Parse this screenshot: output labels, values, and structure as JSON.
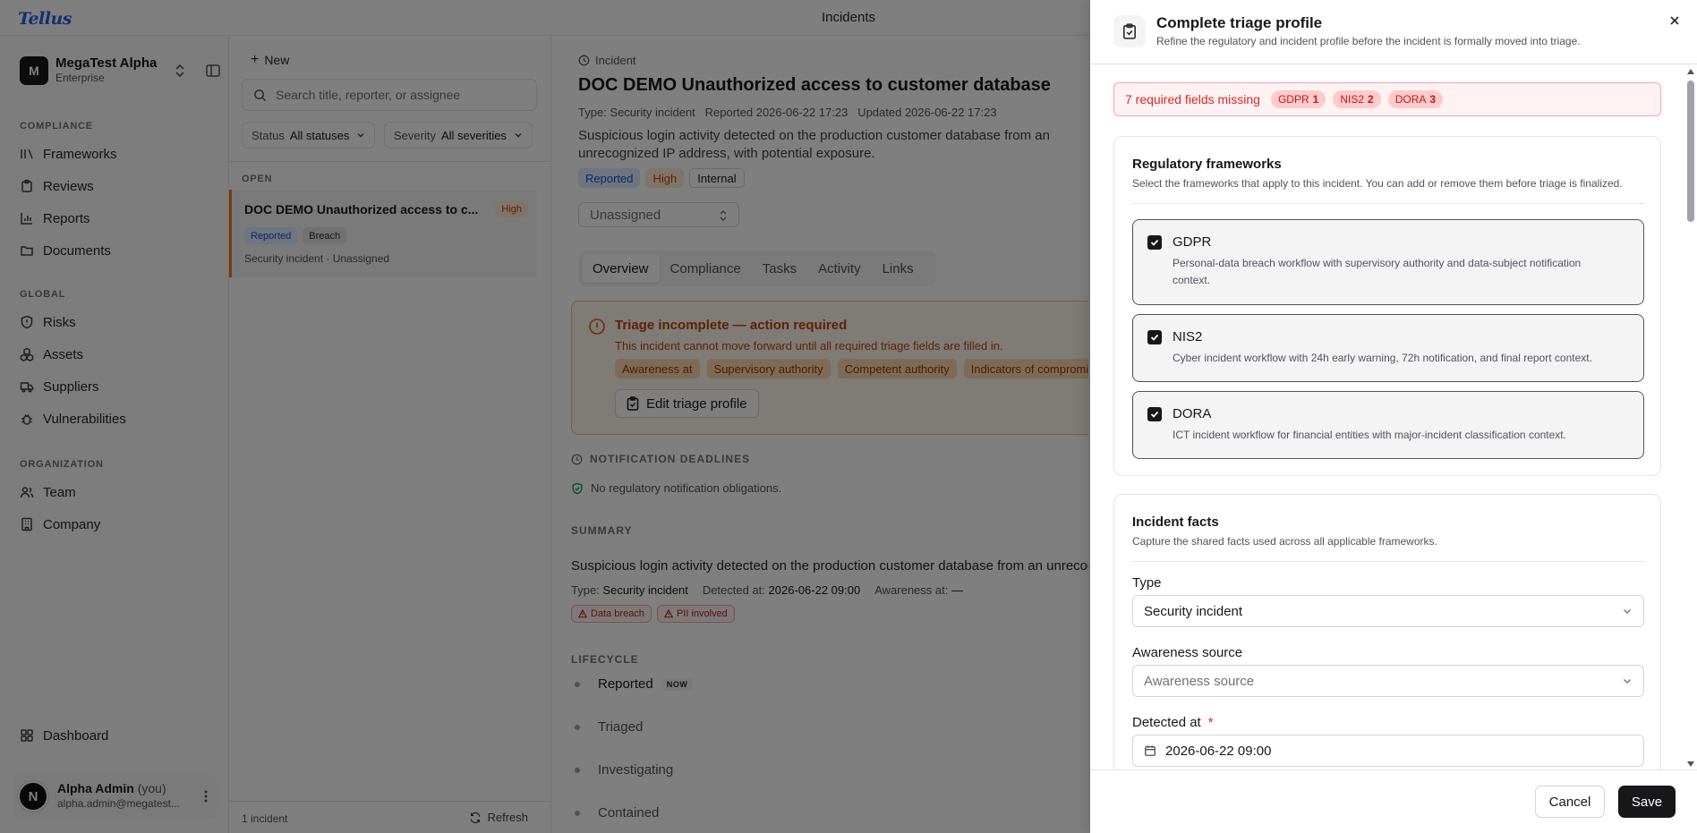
{
  "app": {
    "logo": "Tellus",
    "page_title": "Incidents"
  },
  "sidebar": {
    "org_initial": "M",
    "org_name": "MegaTest Alpha",
    "org_plan": "Enterprise",
    "sections": [
      {
        "label": "COMPLIANCE",
        "items": [
          {
            "label": "Frameworks",
            "icon": "layers-icon"
          },
          {
            "label": "Reviews",
            "icon": "clipboard-icon"
          },
          {
            "label": "Reports",
            "icon": "bar-chart-icon"
          },
          {
            "label": "Documents",
            "icon": "folder-icon"
          }
        ]
      },
      {
        "label": "GLOBAL",
        "items": [
          {
            "label": "Risks",
            "icon": "shield-alert-icon"
          },
          {
            "label": "Assets",
            "icon": "cubes-icon"
          },
          {
            "label": "Suppliers",
            "icon": "truck-icon"
          },
          {
            "label": "Vulnerabilities",
            "icon": "bug-icon"
          }
        ]
      },
      {
        "label": "ORGANIZATION",
        "items": [
          {
            "label": "Team",
            "icon": "users-icon"
          },
          {
            "label": "Company",
            "icon": "building-icon"
          }
        ]
      }
    ],
    "dashboard_label": "Dashboard",
    "user_initial": "N",
    "user_name": "Alpha Admin",
    "user_you": "(you)",
    "user_email": "alpha.admin@megatest..."
  },
  "list": {
    "new_label": "New",
    "search_placeholder": "Search title, reporter, or assignee",
    "filter_status_label": "Status",
    "filter_status_value": "All statuses",
    "filter_severity_label": "Severity",
    "filter_severity_value": "All severities",
    "group_label": "OPEN",
    "incident": {
      "title": "DOC DEMO Unauthorized access to c...",
      "severity": "High",
      "status": "Reported",
      "category": "Breach",
      "meta": "Security incident · Unassigned"
    },
    "count": "1 incident",
    "refresh_label": "Refresh"
  },
  "detail": {
    "crumb": "Incident",
    "title": "DOC DEMO Unauthorized access to customer database",
    "meta": "Type: Security incident   Reported 2026-06-22 17:23   Updated 2026-06-22 17:23",
    "description": "Suspicious login activity detected on the production customer database from an unrecognized IP address, with potential exposure.",
    "tags": [
      "Reported",
      "High",
      "Internal"
    ],
    "assignee": "Unassigned",
    "tabs": [
      "Overview",
      "Compliance",
      "Tasks",
      "Activity",
      "Links"
    ],
    "alert": {
      "title": "Triage incomplete — action required",
      "description": "This incident cannot move forward until all required triage fields are filled in.",
      "chips": [
        "Awareness at",
        "Supervisory authority",
        "Competent authority",
        "Indicators of compromise"
      ],
      "button": "Edit triage profile"
    },
    "deadlines_label": "NOTIFICATION DEADLINES",
    "no_obligations": "No regulatory notification obligations.",
    "summary_label": "SUMMARY",
    "summary_text": "Suspicious login activity detected on the production customer database from an unrecognized IP address.",
    "summary_type_label": "Type:",
    "summary_type_value": "Security incident",
    "summary_detected_label": "Detected at:",
    "summary_detected_value": "2026-06-22 09:00",
    "summary_awareness_label": "Awareness at:",
    "summary_awareness_value": "—",
    "summary_flags": [
      "Data breach",
      "PII involved"
    ],
    "lifecycle_label": "LIFECYCLE",
    "lifecycle": [
      "Reported",
      "Triaged",
      "Investigating",
      "Contained"
    ],
    "now_label": "NOW"
  },
  "modal": {
    "title": "Complete triage profile",
    "subtitle": "Refine the regulatory and incident profile before the incident is formally moved into triage.",
    "missing_text": "7 required fields missing",
    "missing_counts": [
      {
        "name": "GDPR",
        "count": "1"
      },
      {
        "name": "NIS2",
        "count": "2"
      },
      {
        "name": "DORA",
        "count": "3"
      }
    ],
    "frameworks_title": "Regulatory frameworks",
    "frameworks_sub": "Select the frameworks that apply to this incident. You can add or remove them before triage is finalized.",
    "frameworks": [
      {
        "name": "GDPR",
        "desc": "Personal-data breach workflow with supervisory authority and data-subject notification context.",
        "checked": true
      },
      {
        "name": "NIS2",
        "desc": "Cyber incident workflow with 24h early warning, 72h notification, and final report context.",
        "checked": true
      },
      {
        "name": "DORA",
        "desc": "ICT incident workflow for financial entities with major-incident classification context.",
        "checked": true
      }
    ],
    "facts_title": "Incident facts",
    "facts_sub": "Capture the shared facts used across all applicable frameworks.",
    "type_label": "Type",
    "type_value": "Security incident",
    "awareness_label": "Awareness source",
    "awareness_placeholder": "Awareness source",
    "detected_label": "Detected at",
    "detected_required": "*",
    "detected_value": "2026-06-22 09:00",
    "cancel_label": "Cancel",
    "save_label": "Save"
  }
}
